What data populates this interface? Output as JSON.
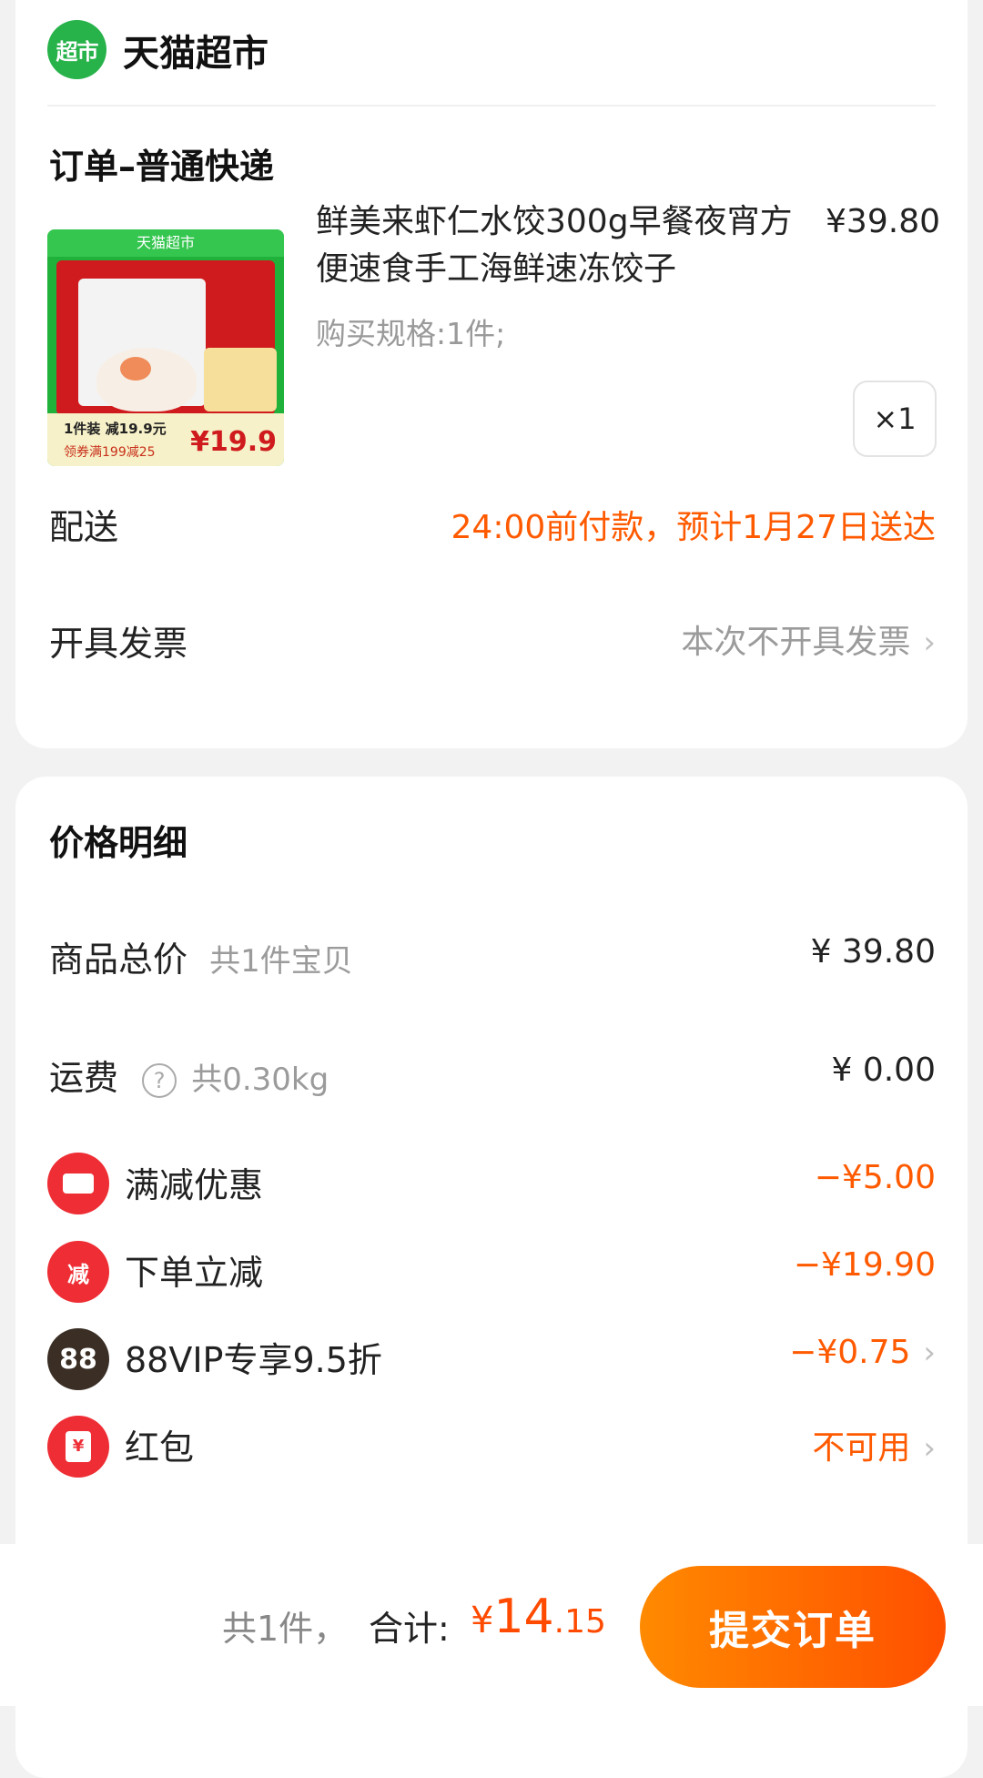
{
  "store": {
    "logo_text": "超市",
    "name": "天猫超市"
  },
  "order": {
    "section_title": "订单–普通快递",
    "product": {
      "image_band_text": "天猫超市",
      "image_promo_text": "1件装 减19.9元",
      "image_coupon_text": "领券满199减25",
      "image_price": "¥19.9",
      "title": "鲜美来虾仁水饺300g早餐夜宵方便速食手工海鲜速冻饺子",
      "price": "¥39.80",
      "spec": "购买规格:1件;",
      "quantity": "×1"
    },
    "delivery": {
      "label": "配送",
      "value": "24:00前付款，预计1月27日送达"
    },
    "invoice": {
      "label": "开具发票",
      "value": "本次不开具发票"
    }
  },
  "price_detail": {
    "title": "价格明细",
    "goods_total": {
      "label": "商品总价",
      "sub": "共1件宝贝",
      "value": "¥ 39.80"
    },
    "shipping": {
      "label": "运费",
      "sub": "共0.30kg",
      "value": "¥ 0.00"
    },
    "discounts": [
      {
        "icon": "ticket-icon",
        "icon_text": "",
        "label": "满减优惠",
        "value": "−¥5.00"
      },
      {
        "icon": "jian-icon",
        "icon_text": "减",
        "label": "下单立减",
        "value": "−¥19.90"
      },
      {
        "icon": "88vip-icon",
        "icon_text": "88",
        "label": "88VIP专享9.5折",
        "value": "−¥0.75"
      },
      {
        "icon": "red-packet-icon",
        "icon_text": "¥",
        "label": "红包",
        "value": "不可用"
      }
    ]
  },
  "footer": {
    "count": "共1件，",
    "total_label": "合计:",
    "currency": "¥",
    "total_int": "14",
    "total_dec": ".15",
    "submit": "提交订单"
  },
  "colors": {
    "accent": "#ff5a00",
    "store_green": "#27b24a",
    "discount_red": "#ee2d34"
  }
}
